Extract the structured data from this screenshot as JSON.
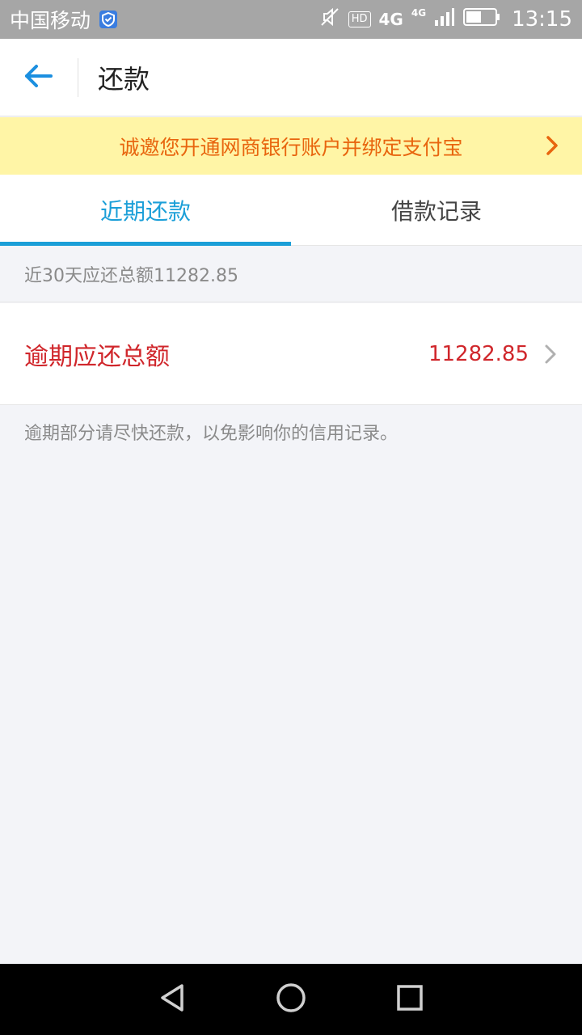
{
  "status_bar": {
    "carrier": "中国移动",
    "hd": "HD",
    "network": "4G",
    "network_small": "4G",
    "time": "13:15"
  },
  "header": {
    "title": "还款"
  },
  "banner": {
    "text": "诚邀您开通网商银行账户并绑定支付宝"
  },
  "tabs": [
    {
      "label": "近期还款",
      "active": true
    },
    {
      "label": "借款记录",
      "active": false
    }
  ],
  "summary": {
    "text": "近30天应还总额11282.85"
  },
  "overdue": {
    "label": "逾期应还总额",
    "amount": "11282.85"
  },
  "note": {
    "text": "逾期部分请尽快还款，以免影响你的信用记录。"
  },
  "colors": {
    "accent": "#1b9fd8",
    "overdue": "#d0262b",
    "banner_bg": "#fff5a6",
    "banner_text": "#e8650e"
  },
  "icons": {
    "back": "arrow-left-icon",
    "banner": "chevron-right-icon",
    "row": "chevron-right-icon",
    "nav_back": "triangle-back-icon",
    "nav_home": "circle-home-icon",
    "nav_recent": "square-recent-icon"
  }
}
